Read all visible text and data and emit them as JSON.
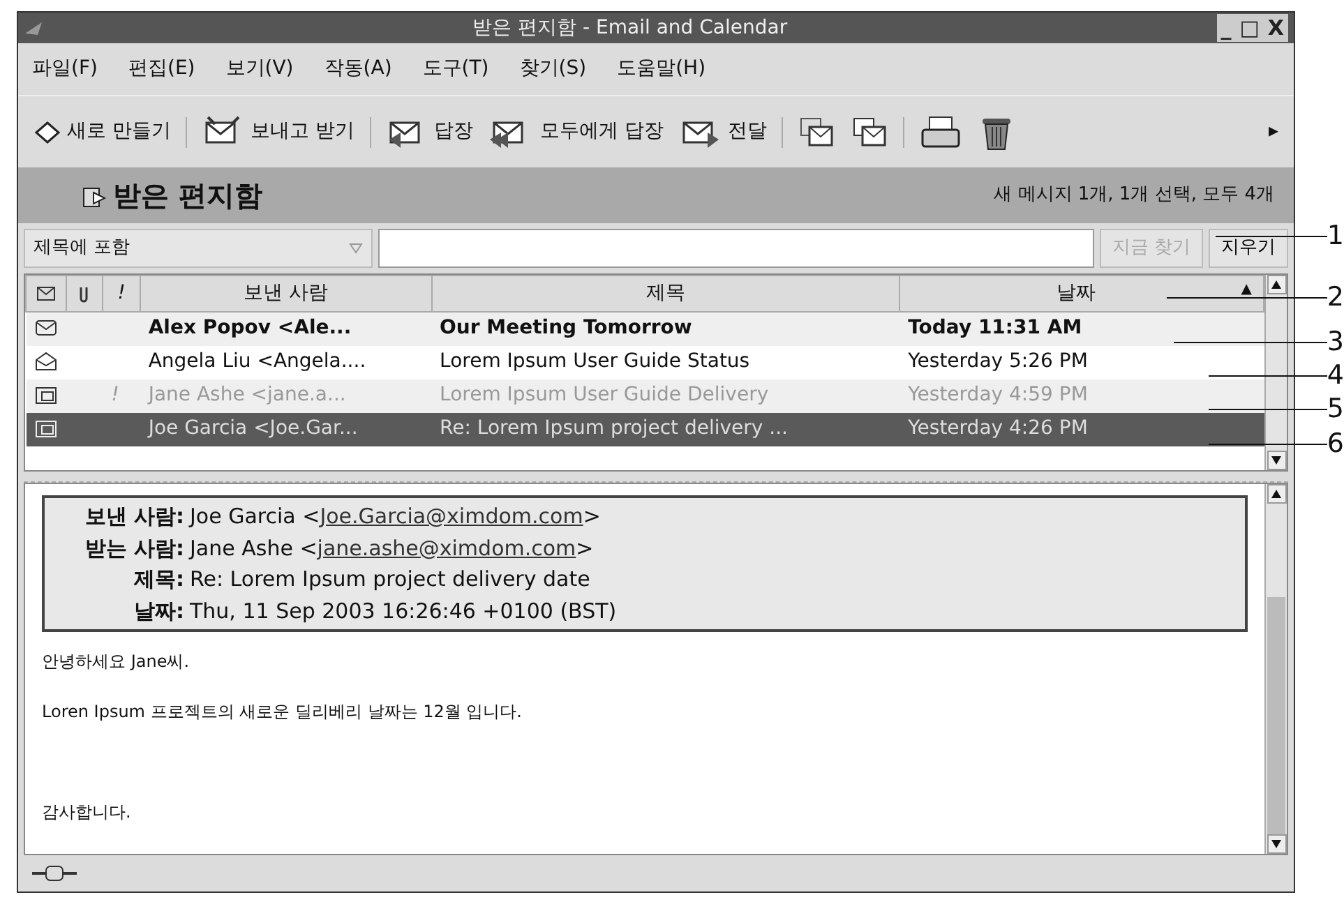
{
  "window": {
    "title": "받은 편지함 - Email and Calendar",
    "controls": [
      "_",
      "□",
      "X"
    ]
  },
  "menu": [
    "파일(F)",
    "편집(E)",
    "보기(V)",
    "작동(A)",
    "도구(T)",
    "찾기(S)",
    "도움말(H)"
  ],
  "toolbar": [
    {
      "kind": "new",
      "label": "새로 만들기"
    },
    {
      "kind": "sendreceive",
      "label": "보내고 받기"
    },
    {
      "kind": "reply",
      "label": "답장"
    },
    {
      "kind": "replyall",
      "label": "모두에게 답장"
    },
    {
      "kind": "forward",
      "label": "전달"
    },
    {
      "kind": "move"
    },
    {
      "kind": "copy"
    },
    {
      "kind": "print"
    },
    {
      "kind": "delete"
    },
    {
      "kind": "more",
      "label": "▸"
    }
  ],
  "folder": {
    "name": "받은 편지함",
    "summary": "새 메시지 1개, 1개 선택, 모두 4개"
  },
  "search": {
    "scope": "제목에 포함",
    "find_button": {
      "label": "지금 찾기",
      "disabled": true
    },
    "clear_button": "지우기"
  },
  "table": {
    "columns": [
      {
        "kind": "status-icon"
      },
      {
        "kind": "attachment-icon"
      },
      {
        "kind": "priority",
        "label": "!"
      },
      {
        "label": "보낸 사람"
      },
      {
        "label": "제목"
      },
      {
        "label": "날짜",
        "sort": "▲"
      }
    ],
    "rows": [
      {
        "kind": "unread",
        "unread": true,
        "dimmed": false,
        "selected": false,
        "priority": "",
        "from": "Alex Popov <Ale...",
        "subject": "Our Meeting Tomorrow",
        "date": "Today 11:31 AM"
      },
      {
        "kind": "read",
        "unread": false,
        "dimmed": false,
        "selected": false,
        "priority": "",
        "from": "Angela Liu <Angela....",
        "subject": "Lorem Ipsum User Guide Status",
        "date": "Yesterday 5:26 PM"
      },
      {
        "kind": "replied",
        "unread": false,
        "dimmed": true,
        "selected": false,
        "priority": "!",
        "from": "Jane Ashe <jane.a...",
        "subject": "Lorem Ipsum User Guide Delivery",
        "date": "Yesterday 4:59 PM"
      },
      {
        "kind": "replied",
        "unread": false,
        "dimmed": false,
        "selected": true,
        "priority": "",
        "from": "Joe Garcia <Joe.Gar...",
        "subject": "Re: Lorem Ipsum project delivery ...",
        "date": "Yesterday 4:26 PM"
      }
    ]
  },
  "preview": {
    "headers": [
      {
        "label": "보낸 사람:",
        "name": "Joe Garcia <",
        "link": "Joe.Garcia@ximdom.com",
        "tail": ">"
      },
      {
        "label": "받는 사람:",
        "name": "Jane Ashe <",
        "link": "jane.ashe@ximdom.com",
        "tail": ">"
      },
      {
        "label": "제목:",
        "name": "Re: Lorem Ipsum project delivery date"
      },
      {
        "label": "날짜:",
        "name": "Thu, 11 Sep 2003 16:26:46 +0100 (BST)"
      }
    ],
    "body": [
      "안녕하세요 Jane씨.",
      "Loren Ipsum 프로젝트의 새로운 딜리베리 날짜는 12월 입니다.",
      "감사합니다."
    ]
  },
  "callouts": [
    "1",
    "2",
    "3",
    "4",
    "5",
    "6"
  ]
}
